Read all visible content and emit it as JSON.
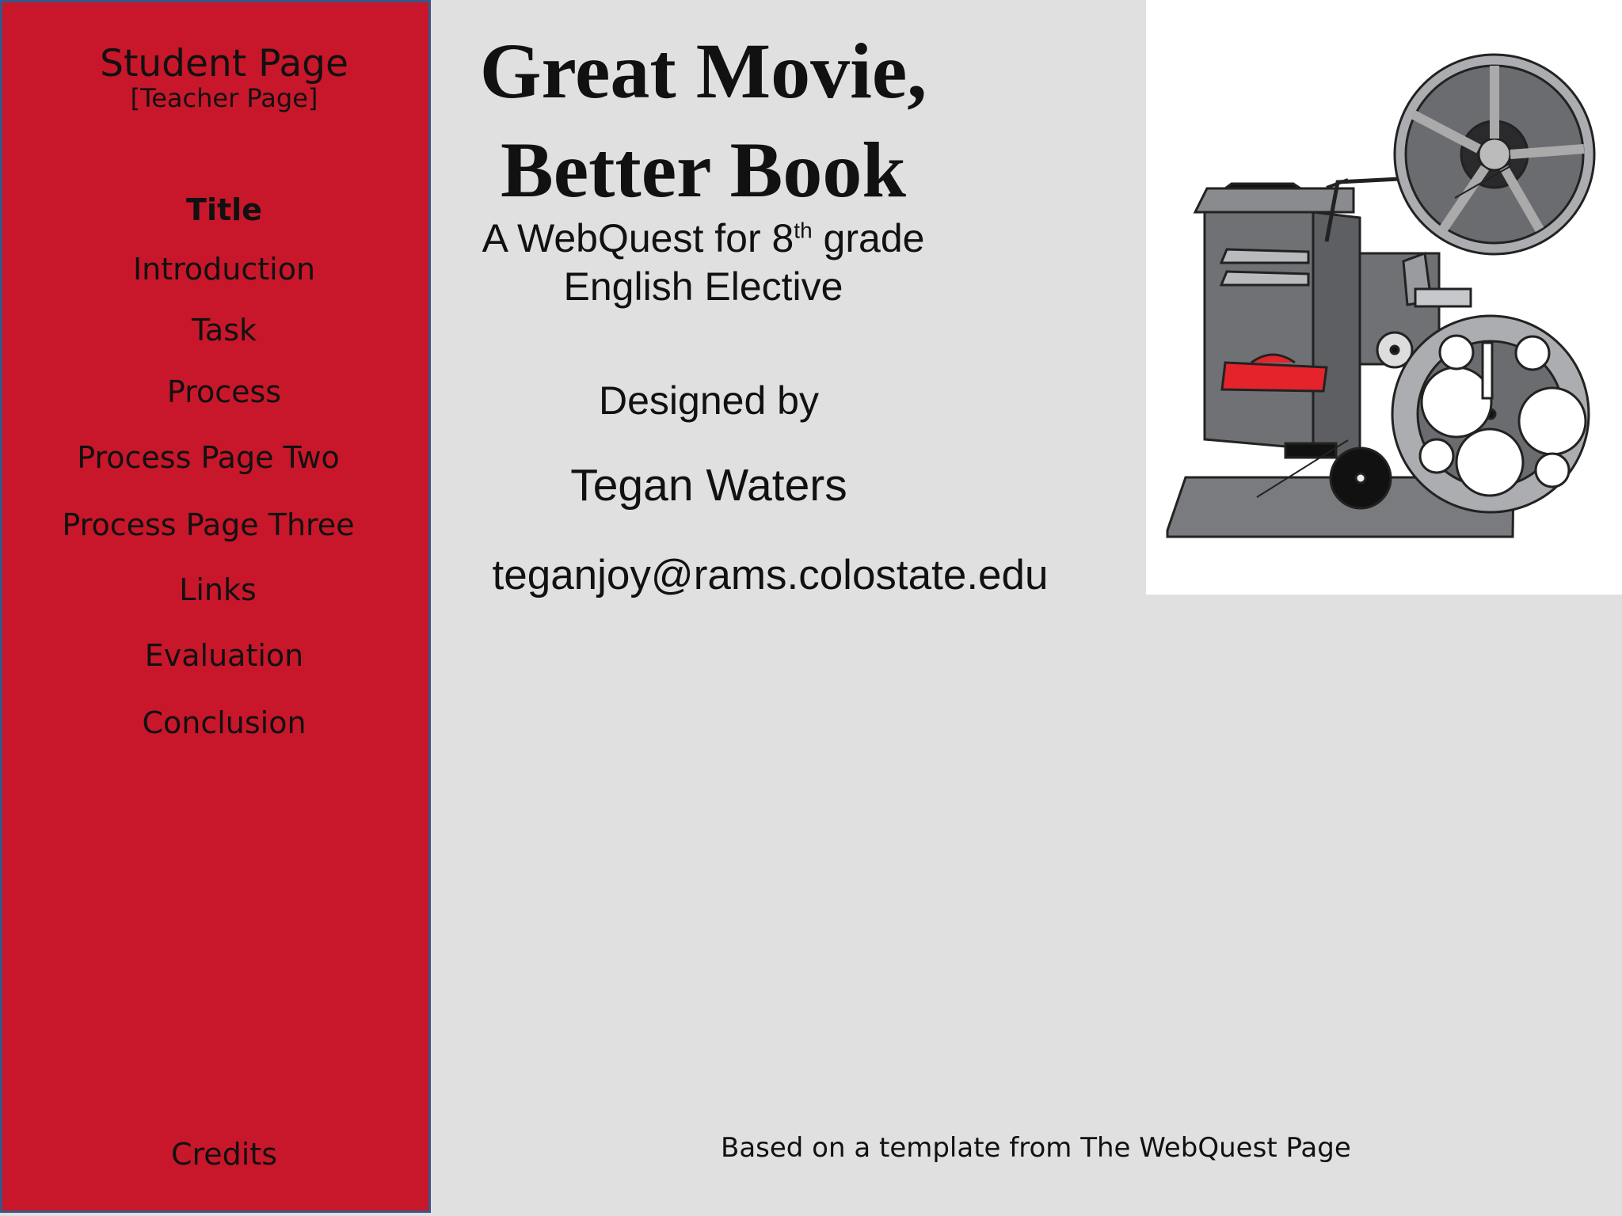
{
  "sidebar": {
    "title": "Student Page",
    "subtitle": "[Teacher Page]",
    "items": [
      {
        "label": "Title",
        "active": true
      },
      {
        "label": "Introduction"
      },
      {
        "label": "Task"
      },
      {
        "label": "Process"
      },
      {
        "label": "Process Page Two"
      },
      {
        "label": "Process Page Three"
      },
      {
        "label": "Links"
      },
      {
        "label": "Evaluation"
      },
      {
        "label": "Conclusion"
      }
    ],
    "credits_label": "Credits"
  },
  "main": {
    "title_line1": "Great Movie,",
    "title_line2": "Better Book",
    "subtitle_line1_pre": "A WebQuest for 8",
    "subtitle_sup": "th",
    "subtitle_line1_post": " grade",
    "subtitle_line2": "English Elective",
    "designed_by": "Designed by",
    "author": "Tegan Waters",
    "email": "teganjoy@rams.colostate.edu",
    "footer": "Based on a template from The WebQuest Page"
  },
  "image": {
    "icon": "film-projector-icon"
  },
  "colors": {
    "sidebar_bg": "#c8172a",
    "sidebar_border": "#3d5486",
    "page_bg": "#dfe0df",
    "projector_red": "#e5232b"
  }
}
